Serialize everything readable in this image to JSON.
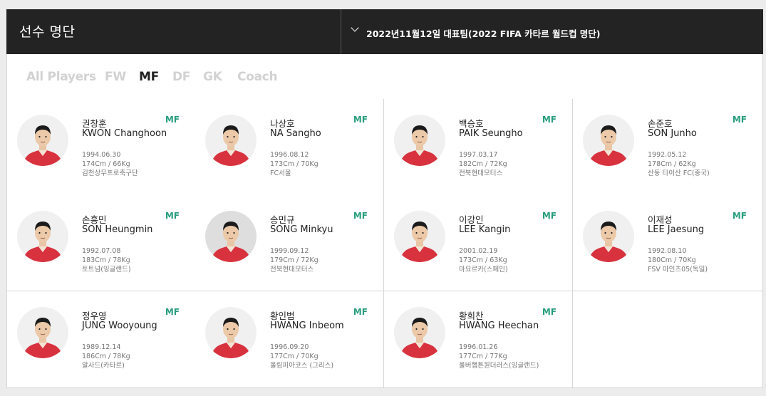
{
  "header": {
    "title": "선수 명단",
    "roster_select": "2022년11월12일 대표팀(2022 FIFA 카타르 월드컵 명단)"
  },
  "tabs": [
    {
      "label": "All Players",
      "active": false
    },
    {
      "label": "FW",
      "active": false
    },
    {
      "label": "MF",
      "active": true
    },
    {
      "label": "DF",
      "active": false
    },
    {
      "label": "GK",
      "active": false
    },
    {
      "label": "Coach",
      "active": false
    }
  ],
  "colors": {
    "header_bg": "#232323",
    "position_accent": "#2a9d7e",
    "jersey_red": "#d8323f",
    "inactive_tab": "#d2d2d2"
  },
  "players": [
    {
      "name_ko": "권창훈",
      "name_en": "KWON Changhoon",
      "position": "MF",
      "birth": "1994.06.30",
      "body": "174Cm / 66Kg",
      "club": "김천상무프로축구단",
      "photo_bg": "light"
    },
    {
      "name_ko": "나상호",
      "name_en": "NA Sangho",
      "position": "MF",
      "birth": "1996.08.12",
      "body": "173Cm / 70Kg",
      "club": "FC서울",
      "photo_bg": "light"
    },
    {
      "name_ko": "백승호",
      "name_en": "PAIK Seungho",
      "position": "MF",
      "birth": "1997.03.17",
      "body": "182Cm / 72Kg",
      "club": "전북현대모터스",
      "photo_bg": "light"
    },
    {
      "name_ko": "손준호",
      "name_en": "SON Junho",
      "position": "MF",
      "birth": "1992.05.12",
      "body": "178Cm / 62Kg",
      "club": "산둥 타이산 FC(중국)",
      "photo_bg": "light"
    },
    {
      "name_ko": "손흥민",
      "name_en": "SON Heungmin",
      "position": "MF",
      "birth": "1992.07.08",
      "body": "183Cm / 78Kg",
      "club": "토트넘(잉글랜드)",
      "photo_bg": "light"
    },
    {
      "name_ko": "송민규",
      "name_en": "SONG Minkyu",
      "position": "MF",
      "birth": "1999.09.12",
      "body": "179Cm / 72Kg",
      "club": "전북현대모터스",
      "photo_bg": "grey"
    },
    {
      "name_ko": "이강인",
      "name_en": "LEE Kangin",
      "position": "MF",
      "birth": "2001.02.19",
      "body": "173Cm / 63Kg",
      "club": "마요르카(스페인)",
      "photo_bg": "light"
    },
    {
      "name_ko": "이재성",
      "name_en": "LEE Jaesung",
      "position": "MF",
      "birth": "1992.08.10",
      "body": "180Cm / 70Kg",
      "club": "FSV 마인츠05(독일)",
      "photo_bg": "light"
    },
    {
      "name_ko": "정우영",
      "name_en": "JUNG Wooyoung",
      "position": "MF",
      "birth": "1989.12.14",
      "body": "186Cm / 78Kg",
      "club": "알사드(카타르)",
      "photo_bg": "light"
    },
    {
      "name_ko": "황인범",
      "name_en": "HWANG Inbeom",
      "position": "MF",
      "birth": "1996.09.20",
      "body": "177Cm / 70Kg",
      "club": "올림피아코스 (그리스)",
      "photo_bg": "light"
    },
    {
      "name_ko": "황희찬",
      "name_en": "HWANG Heechan",
      "position": "MF",
      "birth": "1996.01.26",
      "body": "177Cm / 77Kg",
      "club": "울버햄튼원더러스(잉글랜드)",
      "photo_bg": "light"
    }
  ]
}
